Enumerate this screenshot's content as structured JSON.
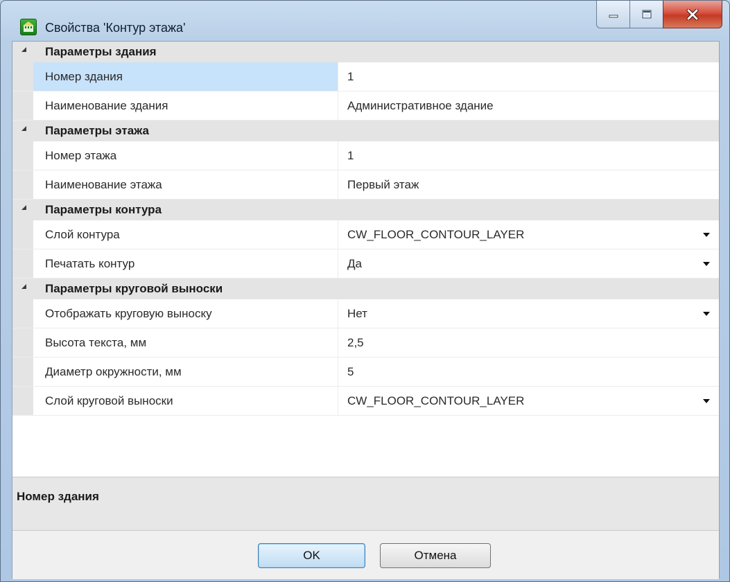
{
  "window": {
    "title": "Свойства 'Контур этажа'"
  },
  "categories": [
    {
      "label": "Параметры здания",
      "rows": [
        {
          "name": "Номер здания",
          "value": "1"
        },
        {
          "name": "Наименование здания",
          "value": "Административное здание"
        }
      ]
    },
    {
      "label": "Параметры этажа",
      "rows": [
        {
          "name": "Номер этажа",
          "value": "1"
        },
        {
          "name": "Наименование этажа",
          "value": "Первый этаж"
        }
      ]
    },
    {
      "label": "Параметры контура",
      "rows": [
        {
          "name": "Слой контура",
          "value": "CW_FLOOR_CONTOUR_LAYER"
        },
        {
          "name": "Печатать контур",
          "value": "Да"
        }
      ]
    },
    {
      "label": "Параметры круговой выноски",
      "rows": [
        {
          "name": "Отображать круговую выноску",
          "value": "Нет"
        },
        {
          "name": "Высота текста, мм",
          "value": "2,5"
        },
        {
          "name": "Диаметр окружности, мм",
          "value": "5"
        },
        {
          "name": "Слой круговой выноски",
          "value": "CW_FLOOR_CONTOUR_LAYER"
        }
      ]
    }
  ],
  "description": {
    "title": "Номер здания"
  },
  "buttons": {
    "ok": "OK",
    "cancel": "Отмена"
  },
  "colors": {
    "selected_row": "#c7e2fb",
    "category_background": "#e4e4e4"
  }
}
